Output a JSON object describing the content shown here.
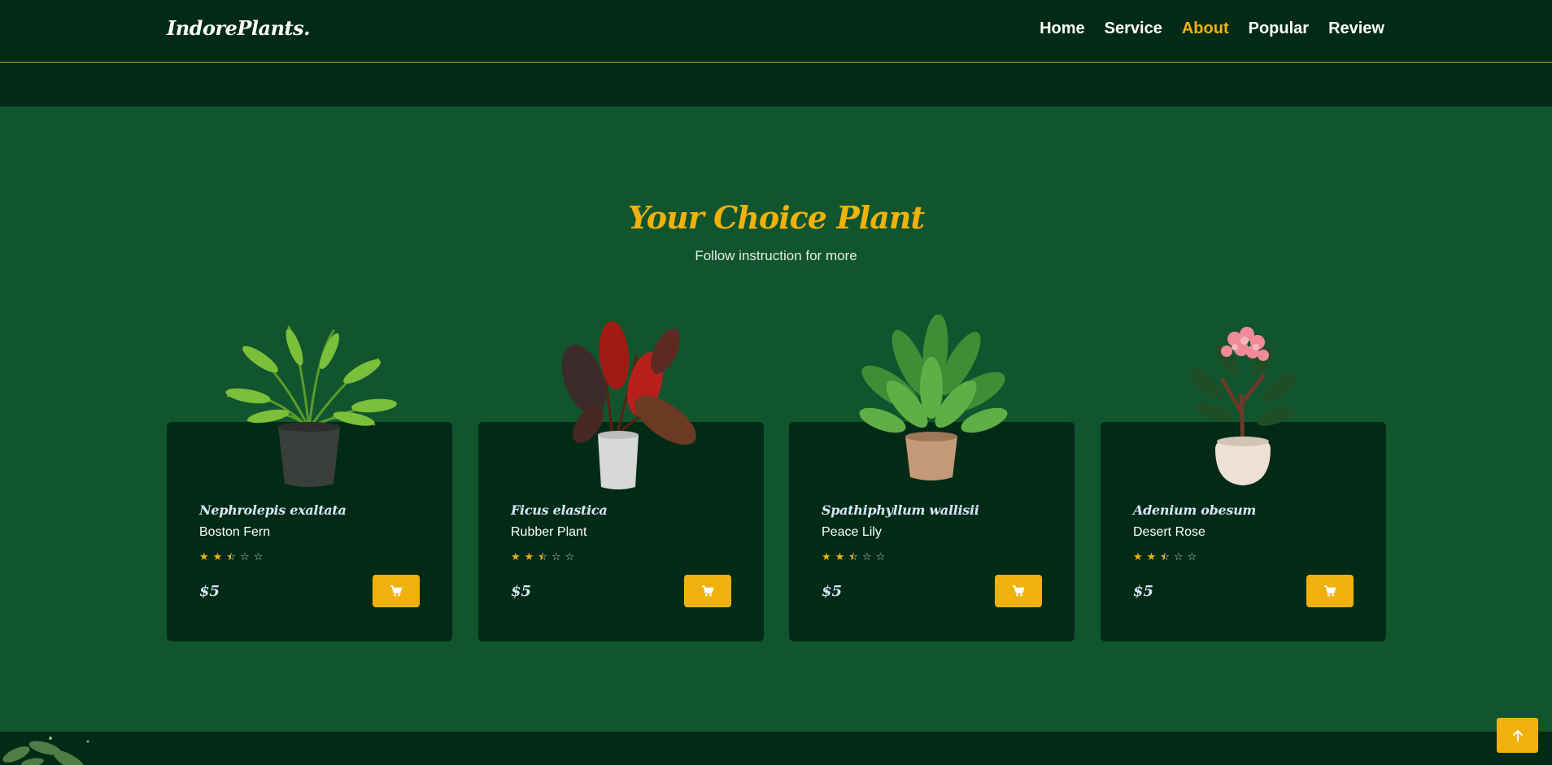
{
  "header": {
    "logo": "IndorePlants.",
    "nav": [
      {
        "label": "Home",
        "active": false
      },
      {
        "label": "Service",
        "active": false
      },
      {
        "label": "About",
        "active": true
      },
      {
        "label": "Popular",
        "active": false
      },
      {
        "label": "Review",
        "active": false
      }
    ]
  },
  "section": {
    "title": "Your Choice Plant",
    "subtitle": "Follow instruction for more"
  },
  "products": [
    {
      "latin": "Nephrolepis exaltata",
      "common": "Boston Fern",
      "rating": 2.5,
      "price": "$5",
      "icon": "cart-icon"
    },
    {
      "latin": "Ficus elastica",
      "common": "Rubber Plant",
      "rating": 2.5,
      "price": "$5",
      "icon": "cart-icon"
    },
    {
      "latin": "Spathiphyllum wallisii",
      "common": "Peace Lily",
      "rating": 2.5,
      "price": "$5",
      "icon": "cart-icon"
    },
    {
      "latin": "Adenium obesum",
      "common": "Desert Rose",
      "rating": 2.5,
      "price": "$5",
      "icon": "cart-icon"
    }
  ],
  "scroll_top": {
    "icon": "arrow-up-icon"
  },
  "colors": {
    "background": "#11552e",
    "dark": "#022b17",
    "accent": "#f1b10c"
  }
}
